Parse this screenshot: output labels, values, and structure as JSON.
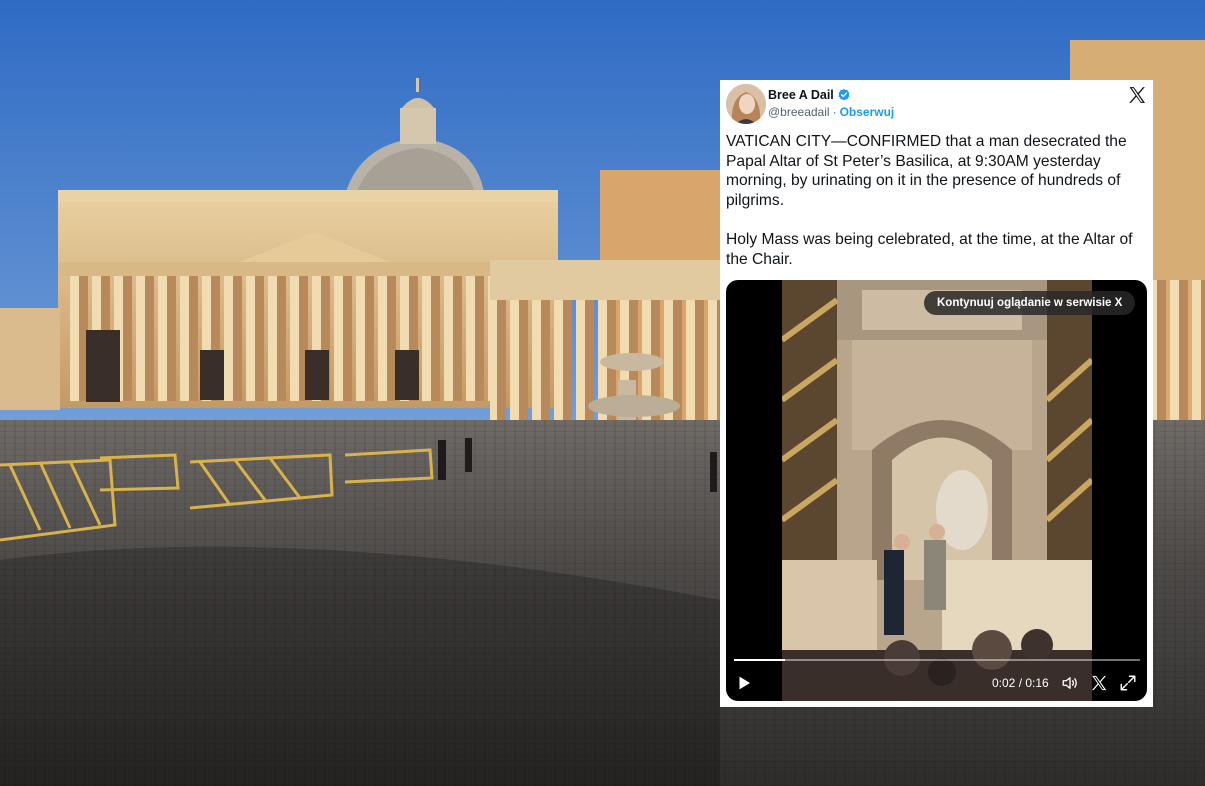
{
  "author": {
    "name": "Bree A Dail",
    "handle": "@breeadail",
    "separator": "·",
    "follow_label": "Obserwuj",
    "verified": true
  },
  "tweet": {
    "paragraphs": [
      "VATICAN CITY—CONFIRMED that a man desecrated the Papal Altar of St Peter’s Basilica, at 9:30AM yesterday morning, by urinating on it in the presence of hundreds of pilgrims.",
      "Holy Mass was being celebrated, at the time, at the Altar of the Chair."
    ]
  },
  "video": {
    "continue_label": "Kontynuuj oglądanie w serwisie X",
    "time_label": "0:02 / 0:16",
    "progress": 0.125
  },
  "icons": {
    "close": "x-logo-icon",
    "verified": "verified-badge-icon",
    "play": "play-icon",
    "volume": "volume-icon",
    "x_small": "x-logo-icon",
    "fullscreen": "fullscreen-icon"
  },
  "colors": {
    "link": "#1d9bf0",
    "text": "#0f1419",
    "muted": "#536471",
    "sky": "#3f78c8"
  }
}
